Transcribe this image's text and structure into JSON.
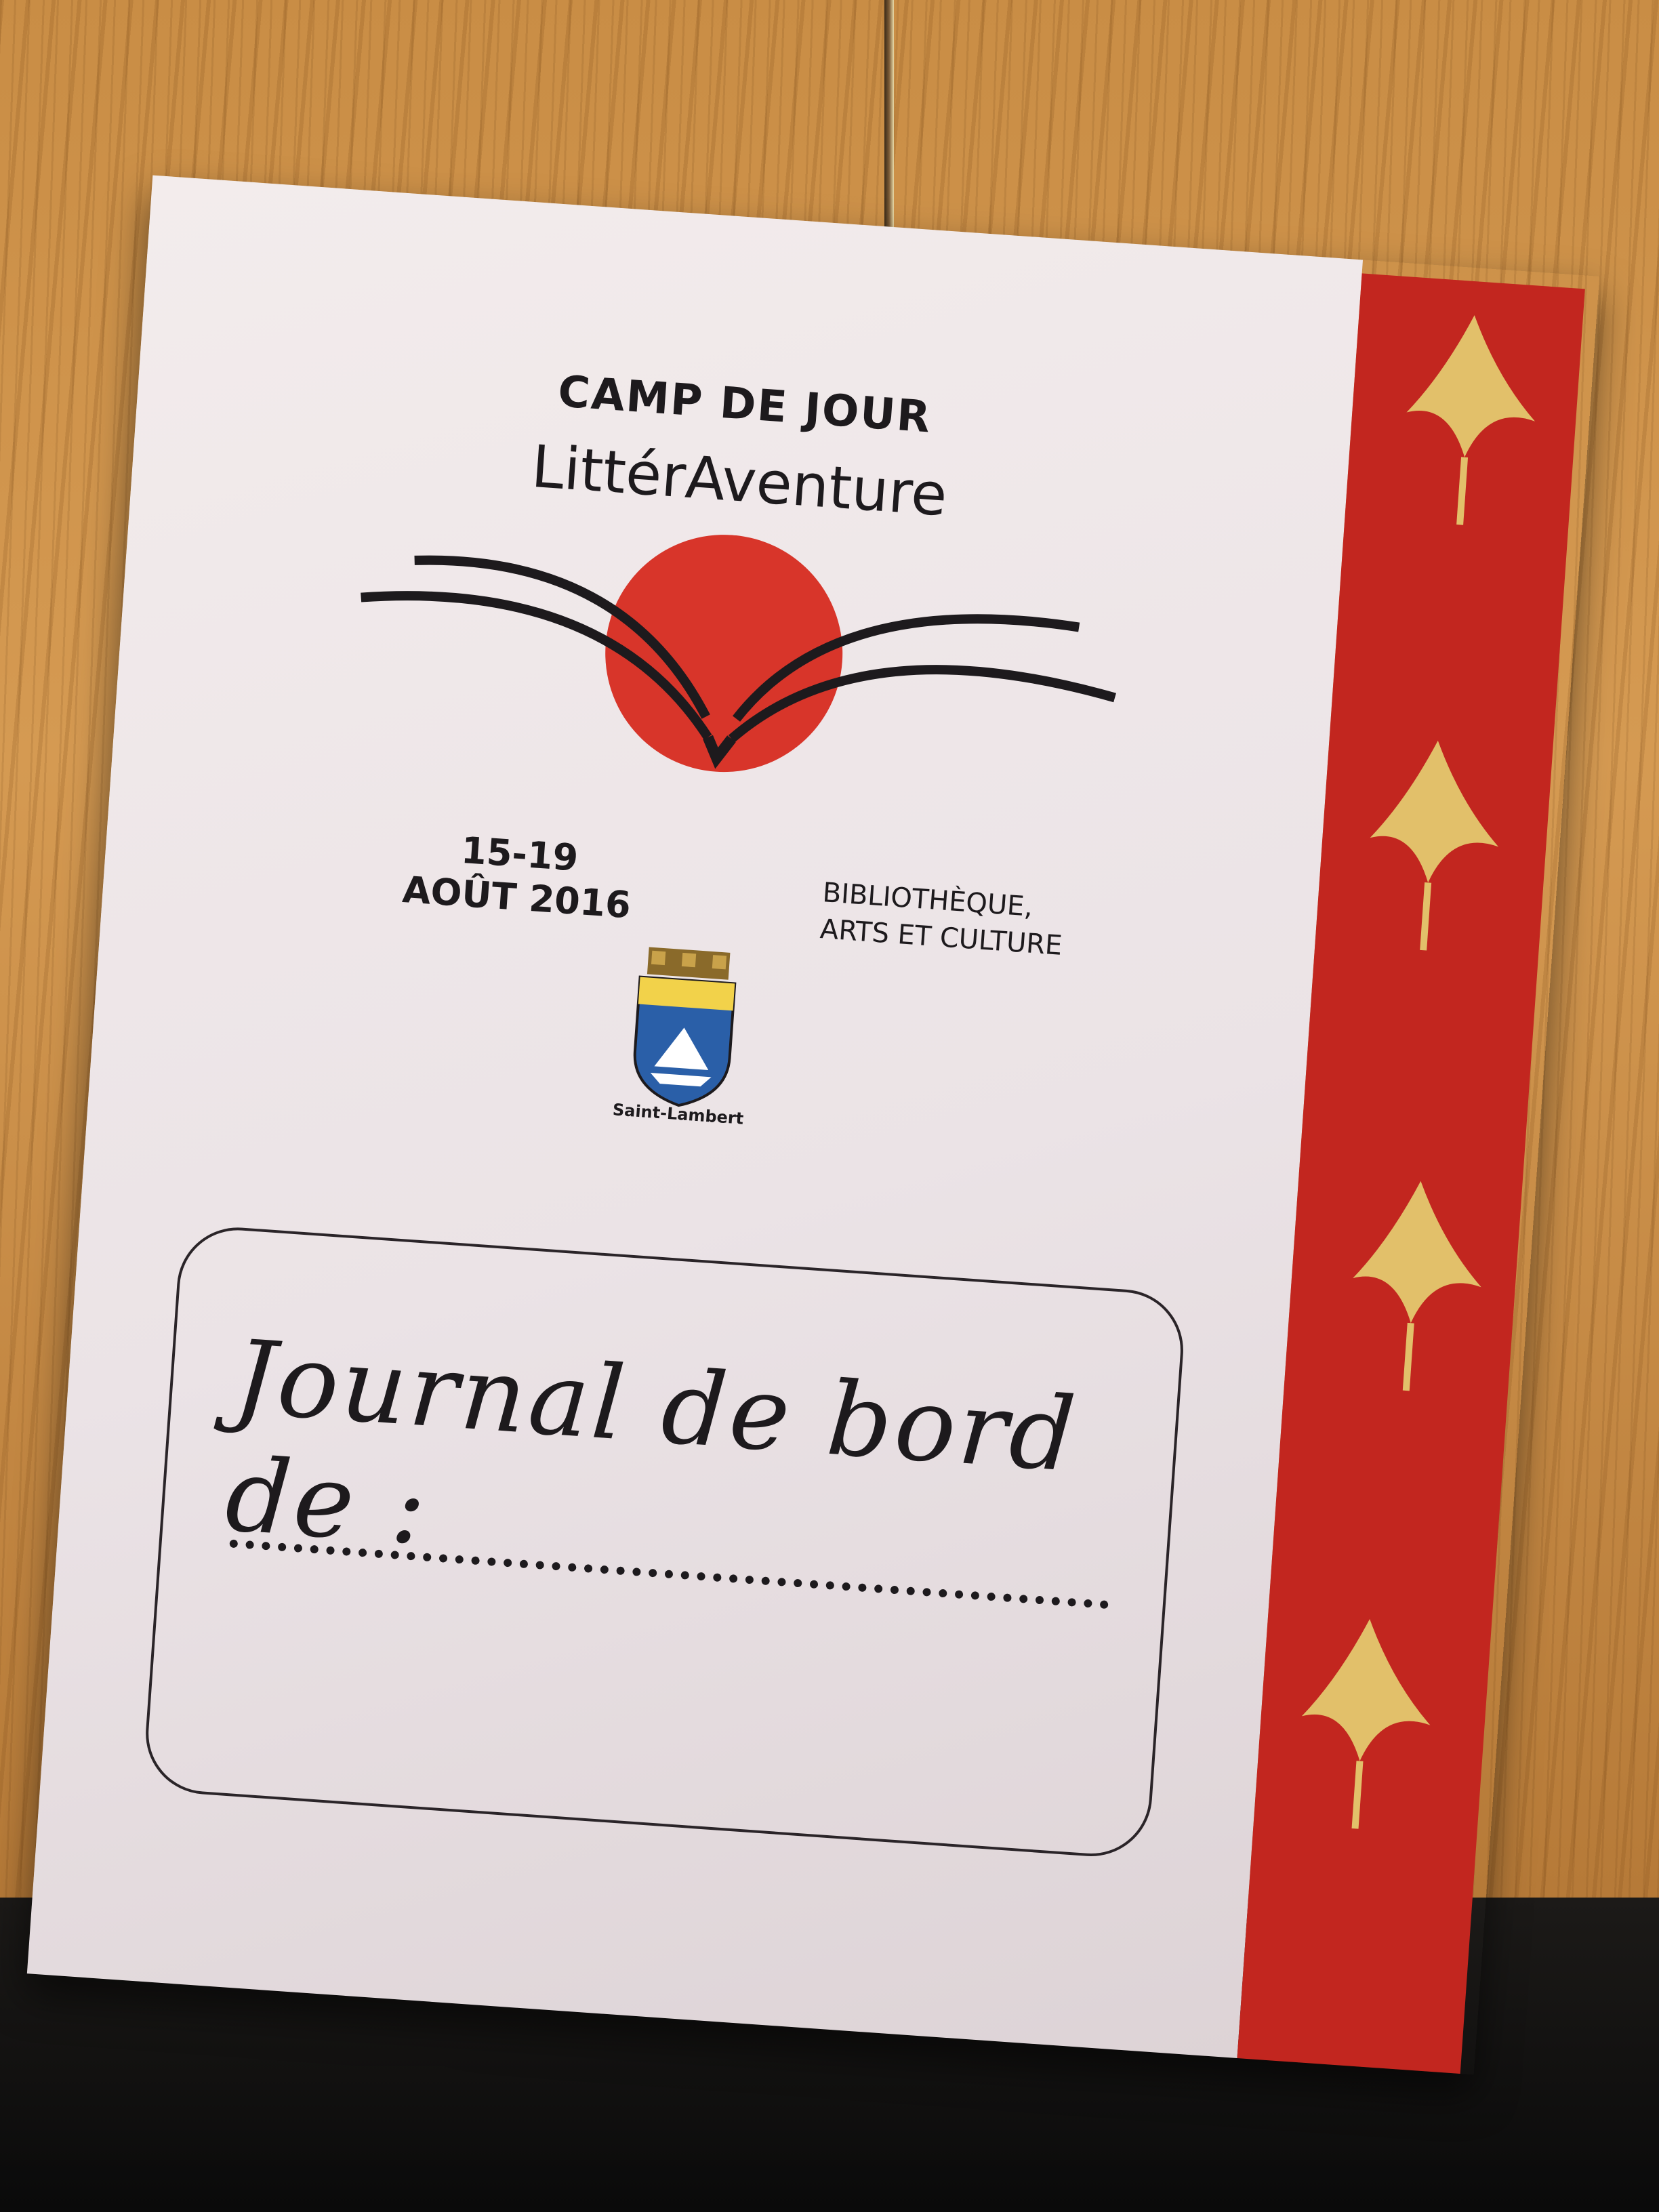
{
  "cover": {
    "camp_label": "CAMP DE JOUR",
    "program_name": "LittérAventure",
    "dates_line1": "15-19",
    "dates_line2": "AOÛT 2016",
    "library_line1": "BIBLIOTHÈQUE,",
    "library_line2": "ARTS ET CULTURE",
    "crest_caption": "Saint-Lambert",
    "journal_label": "Journal de bord de :"
  },
  "colors": {
    "sun_red": "#d8352a",
    "spine_red": "#c2261f",
    "crane_gold": "#e2c06a",
    "ink": "#1d1a1d"
  },
  "icons": [
    "open-book-logo",
    "sun-disc",
    "city-crest-icon",
    "crane-pattern"
  ]
}
